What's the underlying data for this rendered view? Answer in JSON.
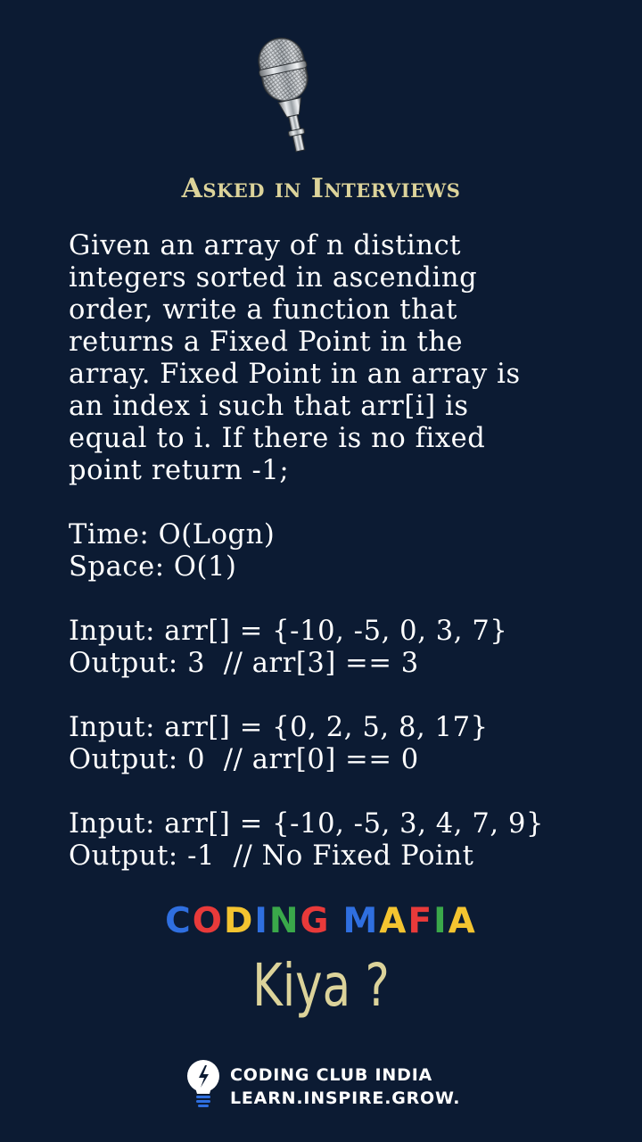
{
  "header": {
    "icon": "microphone-icon",
    "title": "Asked in Interviews"
  },
  "problem": {
    "lines": [
      "Given an array of n distinct",
      "integers sorted in ascending",
      "order, write a function that",
      "returns a Fixed Point in the",
      "array. Fixed Point in an array is",
      "an index i such that arr[i] is",
      "equal to i. If there is no fixed",
      "point return -1;"
    ],
    "complexity": [
      "Time: O(Logn)",
      "Space: O(1)"
    ],
    "examples": [
      {
        "input": "Input: arr[] = {-10, -5, 0, 3, 7}",
        "output": "Output: 3  // arr[3] == 3"
      },
      {
        "input": "Input: arr[] = {0, 2, 5, 8, 17}",
        "output": "Output: 0  // arr[0] == 0"
      },
      {
        "input": "Input: arr[] = {-10, -5, 3, 4, 7, 9}",
        "output": "Output: -1  // No Fixed Point"
      }
    ]
  },
  "brand": {
    "letters": [
      "C",
      "O",
      "D",
      "I",
      "N",
      "G",
      " ",
      "M",
      "A",
      "F",
      "I",
      "A"
    ],
    "letter_colors": [
      "#2f6fe0",
      "#e83a3a",
      "#f4c430",
      "#2f6fe0",
      "#3aa84a",
      "#e83a3a",
      "",
      "#2f6fe0",
      "#f4c430",
      "#e83a3a",
      "#3aa84a",
      "#f4c430"
    ]
  },
  "tagline": "Kiya ?",
  "footer": {
    "icon": "lightbulb-icon",
    "name": "CODING CLUB INDIA",
    "motto": "LEARN.INSPIRE.GROW."
  },
  "colors": {
    "background": "#0c1b33",
    "accent": "#dcd39a",
    "text": "#ffffff"
  }
}
